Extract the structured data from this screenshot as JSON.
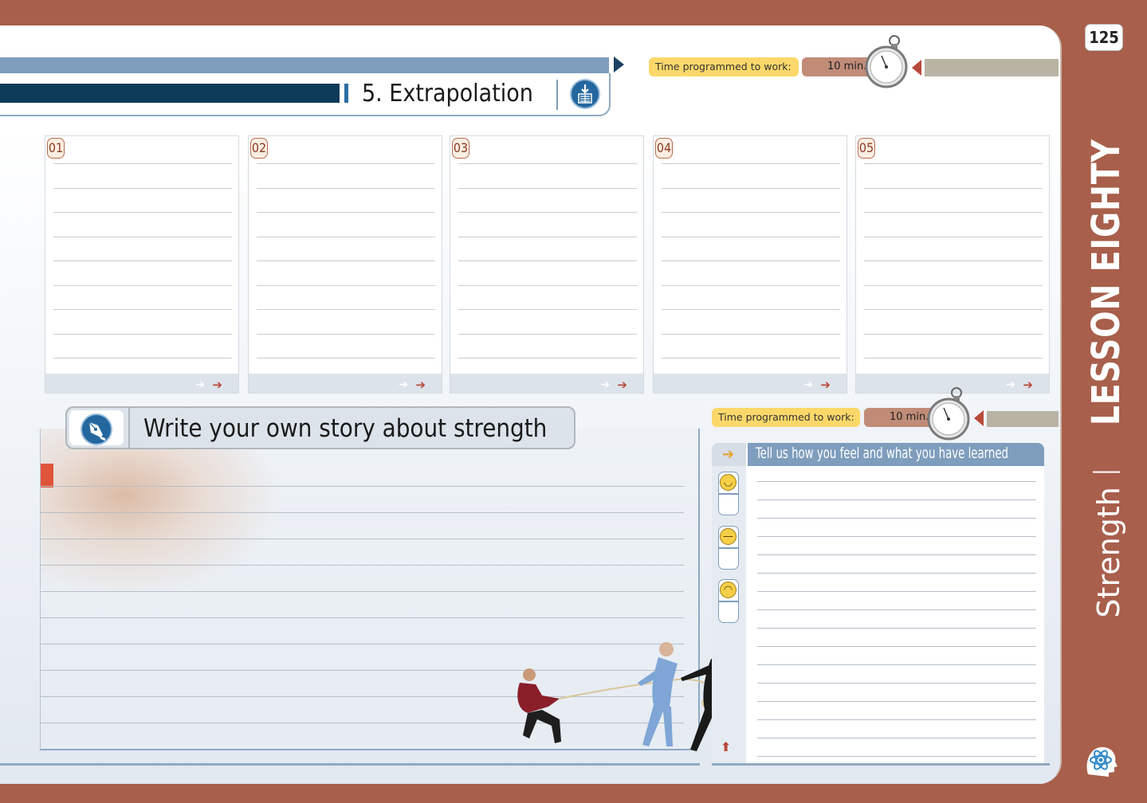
{
  "page_number": "125",
  "side_title": {
    "lesson": "LESSON EIGHTY",
    "topic": "Strength"
  },
  "section": {
    "title": "5. Extrapolation"
  },
  "timer_top": {
    "label": "Time programmed to work:",
    "value": "10 min."
  },
  "cards": [
    {
      "number": "01"
    },
    {
      "number": "02"
    },
    {
      "number": "03"
    },
    {
      "number": "04"
    },
    {
      "number": "05"
    }
  ],
  "story": {
    "title": "Write your own story about strength"
  },
  "timer_bottom": {
    "label": "Time programmed to work:",
    "value": "10 min."
  },
  "feelings": {
    "header": "Tell us how you feel and what you have learned"
  },
  "icons": {
    "download": "download-icon",
    "pen": "pen-nib-icon",
    "atom": "atom-head-icon",
    "stopwatch": "stopwatch-icon"
  },
  "colors": {
    "background": "#a85f4b",
    "accent_blue": "#0e3a5a",
    "header_blue": "#7f9dbd",
    "time_label": "#fcd86a",
    "time_value": "#c08c78"
  }
}
